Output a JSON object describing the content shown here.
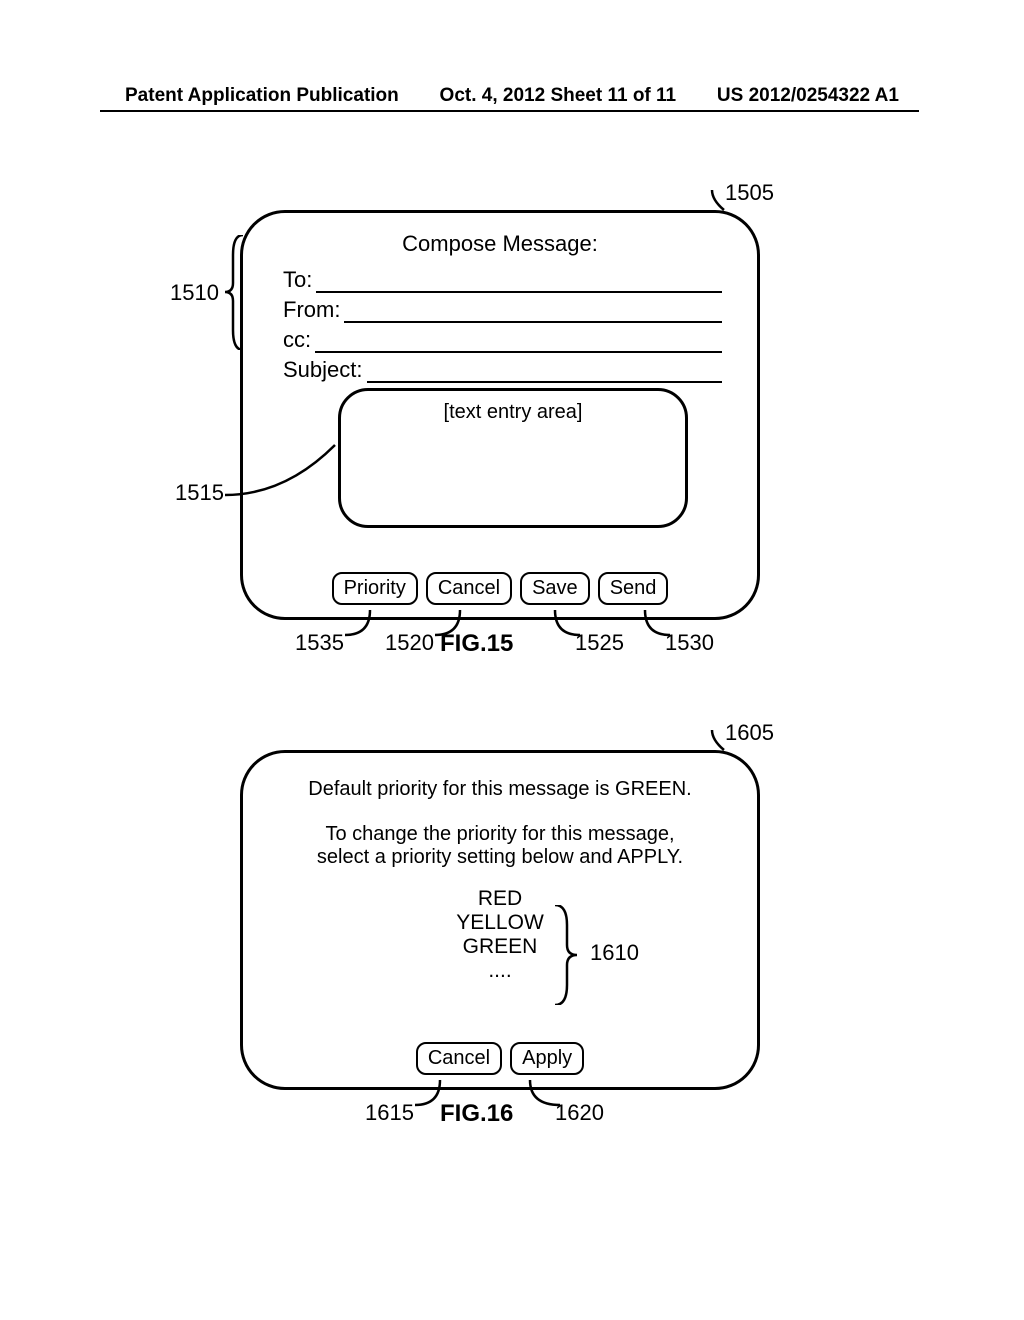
{
  "header": {
    "left": "Patent Application Publication",
    "center": "Oct. 4, 2012  Sheet 11 of 11",
    "right": "US 2012/0254322 A1"
  },
  "fig15": {
    "title": "Compose Message:",
    "fields": {
      "to": "To:",
      "from": "From:",
      "cc": "cc:",
      "subject": "Subject:"
    },
    "textarea_placeholder": "[text entry area]",
    "buttons": {
      "priority": "Priority",
      "cancel": "Cancel",
      "save": "Save",
      "send": "Send"
    },
    "figlabel": "FIG.15",
    "refs": {
      "r1505": "1505",
      "r1510": "1510",
      "r1515": "1515",
      "r1520": "1520",
      "r1525": "1525",
      "r1530": "1530",
      "r1535": "1535"
    }
  },
  "fig16": {
    "line1": "Default priority for this message is GREEN.",
    "line2a": "To change the priority for this message,",
    "line2b": "select a priority setting below and APPLY.",
    "options": {
      "red": "RED",
      "yellow": "YELLOW",
      "green": "GREEN",
      "more": "...."
    },
    "buttons": {
      "cancel": "Cancel",
      "apply": "Apply"
    },
    "figlabel": "FIG.16",
    "refs": {
      "r1605": "1605",
      "r1610": "1610",
      "r1615": "1615",
      "r1620": "1620"
    }
  }
}
